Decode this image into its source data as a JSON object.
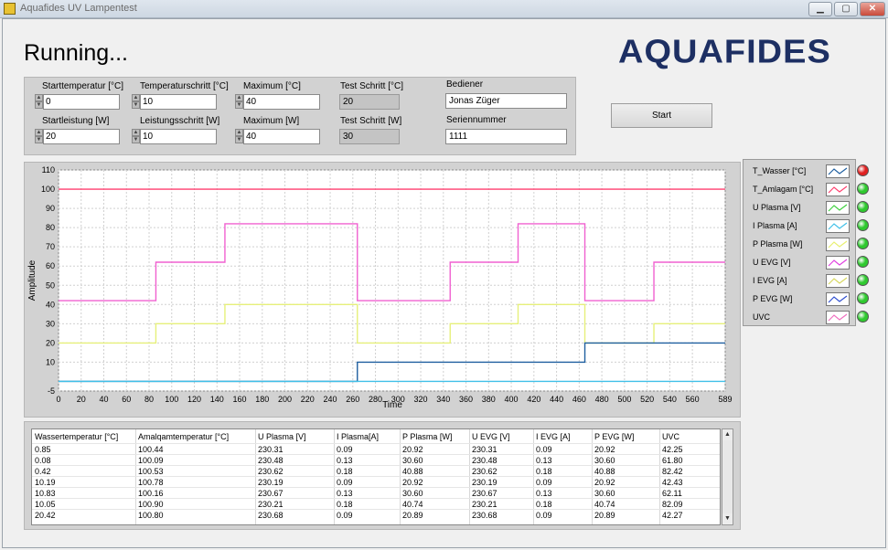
{
  "window": {
    "title": "Aquafides UV Lampentest",
    "minimize": "▁",
    "maximize": "▢",
    "close": "✕"
  },
  "status": "Running...",
  "logo": "AQUAFIDES",
  "controls": {
    "starttemp": {
      "label": "Starttemperatur [°C]",
      "value": "0"
    },
    "tempstep": {
      "label": "Temperaturschritt [°C]",
      "value": "10"
    },
    "maxtemp": {
      "label": "Maximum [°C]",
      "value": "40"
    },
    "teststep_c": {
      "label": "Test Schritt [°C]",
      "value": "20"
    },
    "operator": {
      "label": "Bediener",
      "value": "Jonas Züger"
    },
    "startpower": {
      "label": "Startleistung [W]",
      "value": "20"
    },
    "powerstep": {
      "label": "Leistungsschritt [W]",
      "value": "10"
    },
    "maxpower": {
      "label": "Maximum [W]",
      "value": "40"
    },
    "teststep_w": {
      "label": "Test Schritt [W]",
      "value": "30"
    },
    "serial": {
      "label": "Seriennummer",
      "value": "1111"
    },
    "start_button": "Start"
  },
  "legend": [
    {
      "name": "T_Wasser [°C]",
      "color": "#1f5fa0",
      "led": "#e02020"
    },
    {
      "name": "T_Amlagam [°C]",
      "color": "#ff3f6f",
      "led": "#2fc92f"
    },
    {
      "name": "U Plasma [V]",
      "color": "#40d040",
      "led": "#2fc92f"
    },
    {
      "name": "I Plasma [A]",
      "color": "#40c0e8",
      "led": "#2fc92f"
    },
    {
      "name": "P Plasma [W]",
      "color": "#e8f070",
      "led": "#2fc92f"
    },
    {
      "name": "U EVG [V]",
      "color": "#e040e0",
      "led": "#2fc92f"
    },
    {
      "name": "I EVG [A]",
      "color": "#d8d860",
      "led": "#2fc92f"
    },
    {
      "name": "P EVG [W]",
      "color": "#3050d0",
      "led": "#2fc92f"
    },
    {
      "name": "UVC",
      "color": "#f070c0",
      "led": "#2fc92f"
    }
  ],
  "chart_data": {
    "type": "line",
    "xlabel": "Time",
    "ylabel": "Amplitude",
    "xlim": [
      0,
      589
    ],
    "ylim": [
      -5,
      110
    ],
    "xticks": [
      0,
      20,
      40,
      60,
      80,
      100,
      120,
      140,
      160,
      180,
      200,
      220,
      240,
      260,
      280,
      300,
      320,
      340,
      360,
      380,
      400,
      420,
      440,
      460,
      480,
      500,
      520,
      540,
      560,
      589
    ],
    "yticks": [
      110,
      100,
      90,
      80,
      70,
      60,
      50,
      40,
      30,
      20,
      10,
      -5
    ],
    "grid": true,
    "series": [
      {
        "name": "T_Amlagam [°C]",
        "color": "#ff3f6f",
        "points": [
          [
            0,
            100
          ],
          [
            589,
            100
          ]
        ]
      },
      {
        "name": "UVC",
        "color": "#f060d0",
        "points": [
          [
            0,
            42
          ],
          [
            85,
            42
          ],
          [
            86,
            62
          ],
          [
            146,
            62
          ],
          [
            147,
            82
          ],
          [
            263,
            82
          ],
          [
            264,
            42
          ],
          [
            345,
            42
          ],
          [
            346,
            62
          ],
          [
            405,
            62
          ],
          [
            406,
            82
          ],
          [
            464,
            82
          ],
          [
            465,
            42
          ],
          [
            525,
            42
          ],
          [
            526,
            62
          ],
          [
            589,
            62
          ]
        ]
      },
      {
        "name": "P EVG [W]",
        "color": "#e6f07a",
        "points": [
          [
            0,
            20
          ],
          [
            85,
            20
          ],
          [
            86,
            30
          ],
          [
            146,
            30
          ],
          [
            147,
            40
          ],
          [
            263,
            40
          ],
          [
            264,
            20
          ],
          [
            345,
            20
          ],
          [
            346,
            30
          ],
          [
            405,
            30
          ],
          [
            406,
            40
          ],
          [
            464,
            40
          ],
          [
            465,
            20
          ],
          [
            525,
            20
          ],
          [
            526,
            30
          ],
          [
            589,
            30
          ]
        ]
      },
      {
        "name": "T_Wasser [°C]",
        "color": "#1f5fa0",
        "points": [
          [
            0,
            0
          ],
          [
            263,
            0
          ],
          [
            264,
            10
          ],
          [
            464,
            10
          ],
          [
            465,
            20
          ],
          [
            589,
            20
          ]
        ]
      },
      {
        "name": "I Plasma [A]",
        "color": "#40c0e8",
        "points": [
          [
            0,
            0
          ],
          [
            589,
            0
          ]
        ]
      }
    ]
  },
  "table": {
    "headers": [
      "Wassertemperatur [°C]",
      "Amalqamtemperatur [°C]",
      "U Plasma [V]",
      "I Plasma[A]",
      "P Plasma [W]",
      "U EVG [V]",
      "I EVG [A]",
      "P EVG [W]",
      "UVC"
    ],
    "rows": [
      [
        "0.85",
        "100.44",
        "230.31",
        "0.09",
        "20.92",
        "230.31",
        "0.09",
        "20.92",
        "42.25"
      ],
      [
        "0.08",
        "100.09",
        "230.48",
        "0.13",
        "30.60",
        "230.48",
        "0.13",
        "30.60",
        "61.80"
      ],
      [
        "0.42",
        "100.53",
        "230.62",
        "0.18",
        "40.88",
        "230.62",
        "0.18",
        "40.88",
        "82.42"
      ],
      [
        "10.19",
        "100.78",
        "230.19",
        "0.09",
        "20.92",
        "230.19",
        "0.09",
        "20.92",
        "42.43"
      ],
      [
        "10.83",
        "100.16",
        "230.67",
        "0.13",
        "30.60",
        "230.67",
        "0.13",
        "30.60",
        "62.11"
      ],
      [
        "10.05",
        "100.90",
        "230.21",
        "0.18",
        "40.74",
        "230.21",
        "0.18",
        "40.74",
        "82.09"
      ],
      [
        "20.42",
        "100.80",
        "230.68",
        "0.09",
        "20.89",
        "230.68",
        "0.09",
        "20.89",
        "42.27"
      ]
    ]
  }
}
